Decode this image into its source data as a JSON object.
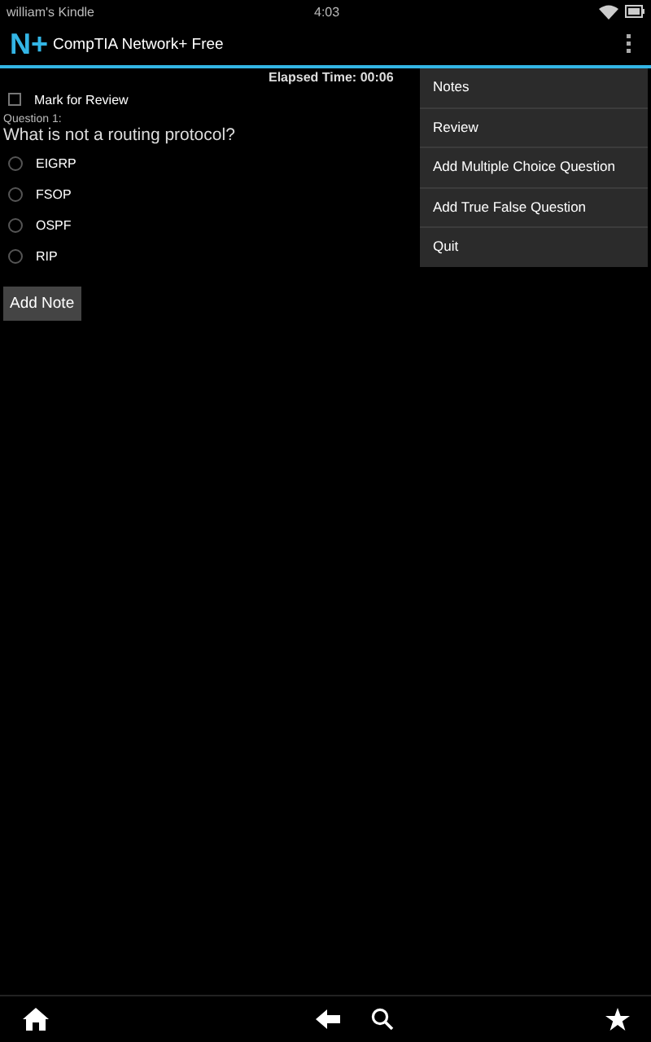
{
  "status_bar": {
    "device": "william's Kindle",
    "time": "4:03"
  },
  "app_bar": {
    "logo": "N+",
    "title": "CompTIA Network+ Free"
  },
  "elapsed": "Elapsed Time: 00:06",
  "mark_for_review": {
    "label": "Mark for Review",
    "checked": false
  },
  "question": {
    "number": "Question 1:",
    "text": "What is not a routing protocol?",
    "options": [
      {
        "label": "EIGRP",
        "selected": false
      },
      {
        "label": "FSOP",
        "selected": false
      },
      {
        "label": "OSPF",
        "selected": false
      },
      {
        "label": "RIP",
        "selected": false
      }
    ]
  },
  "add_note": "Add Note",
  "menu": [
    "Notes",
    "Review",
    "Add Multiple Choice Question",
    "Add True False Question",
    "Quit"
  ]
}
